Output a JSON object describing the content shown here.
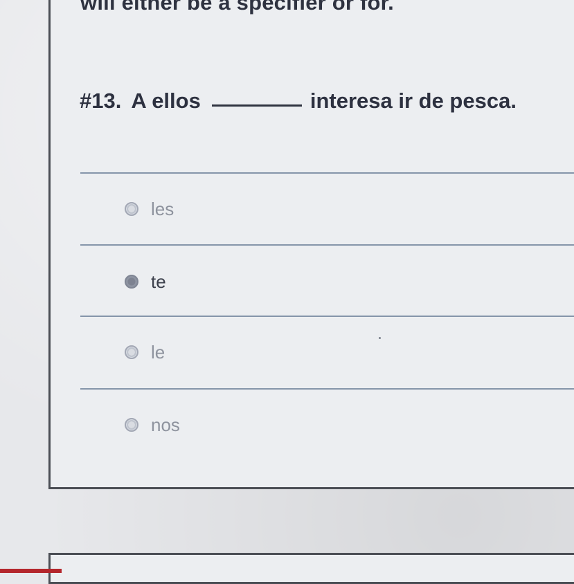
{
  "question": {
    "cut_top_text": "will either be a specifier or for.",
    "number": "#13.",
    "prefix": "A ellos",
    "suffix": "interesa ir de pesca."
  },
  "choices": [
    {
      "label": "les",
      "selected": false
    },
    {
      "label": "te",
      "selected": true
    },
    {
      "label": "le",
      "selected": false
    },
    {
      "label": "nos",
      "selected": false
    }
  ]
}
